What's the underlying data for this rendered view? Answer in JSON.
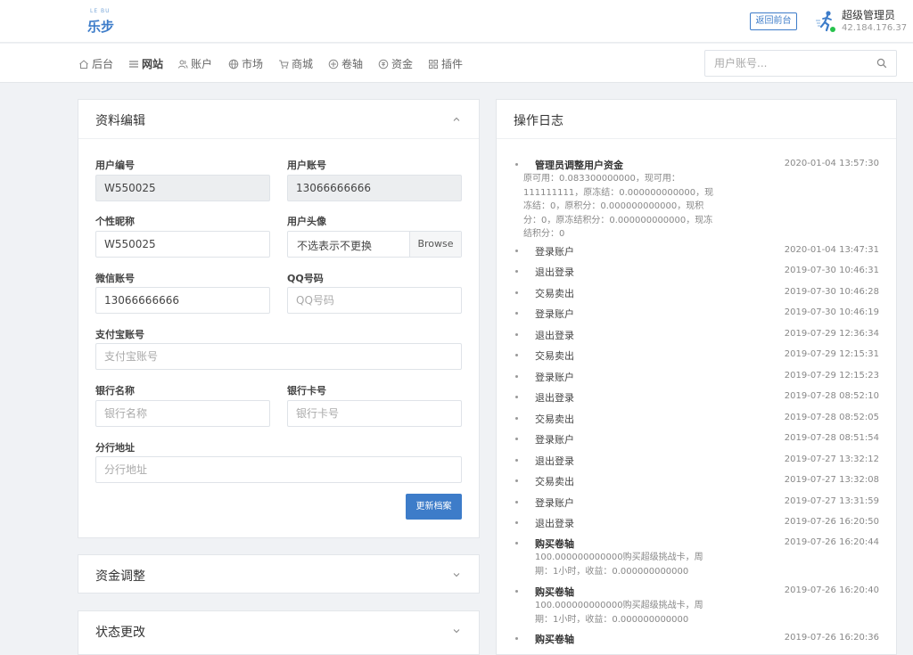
{
  "header": {
    "logo_sup": "LE BU",
    "logo_text": "乐步",
    "back_button": "返回前台",
    "admin_name": "超级管理员",
    "admin_ip": "42.184.176.37"
  },
  "nav": {
    "items": [
      {
        "label": "后台",
        "icon": "home-icon"
      },
      {
        "label": "网站",
        "icon": "list-icon"
      },
      {
        "label": "账户",
        "icon": "users-icon"
      },
      {
        "label": "市场",
        "icon": "globe-icon"
      },
      {
        "label": "商城",
        "icon": "cart-icon"
      },
      {
        "label": "卷轴",
        "icon": "scroll-icon"
      },
      {
        "label": "资金",
        "icon": "coin-icon"
      },
      {
        "label": "插件",
        "icon": "grid-icon"
      }
    ],
    "search_placeholder": "用户账号..."
  },
  "profile": {
    "title": "资料编辑",
    "user_id_label": "用户编号",
    "user_id_value": "W550025",
    "account_label": "用户账号",
    "account_value": "13066666666",
    "nickname_label": "个性昵称",
    "nickname_value": "W550025",
    "avatar_label": "用户头像",
    "avatar_value": "不选表示不更换",
    "avatar_button": "Browse",
    "wechat_label": "微信账号",
    "wechat_value": "13066666666",
    "qq_label": "QQ号码",
    "qq_placeholder": "QQ号码",
    "alipay_label": "支付宝账号",
    "alipay_placeholder": "支付宝账号",
    "bank_name_label": "银行名称",
    "bank_name_placeholder": "银行名称",
    "bank_card_label": "银行卡号",
    "bank_card_placeholder": "银行卡号",
    "branch_label": "分行地址",
    "branch_placeholder": "分行地址",
    "submit_label": "更新档案"
  },
  "funds": {
    "title": "资金调整"
  },
  "status": {
    "title": "状态更改"
  },
  "log": {
    "title": "操作日志",
    "entries": [
      {
        "title": "管理员调整用户资金",
        "time": "2020-01-04 13:57:30",
        "detail": "原可用：0.083300000000，现可用：111111111，原冻结：0.000000000000，现冻结：0，原积分：0.000000000000，现积分：0，原冻结积分：0.000000000000，现冻结积分：0"
      },
      {
        "title": "登录账户",
        "time": "2020-01-04 13:47:31"
      },
      {
        "title": "退出登录",
        "time": "2019-07-30 10:46:31"
      },
      {
        "title": "交易卖出",
        "time": "2019-07-30 10:46:28"
      },
      {
        "title": "登录账户",
        "time": "2019-07-30 10:46:19"
      },
      {
        "title": "退出登录",
        "time": "2019-07-29 12:36:34"
      },
      {
        "title": "交易卖出",
        "time": "2019-07-29 12:15:31"
      },
      {
        "title": "登录账户",
        "time": "2019-07-29 12:15:23"
      },
      {
        "title": "退出登录",
        "time": "2019-07-28 08:52:10"
      },
      {
        "title": "交易卖出",
        "time": "2019-07-28 08:52:05"
      },
      {
        "title": "登录账户",
        "time": "2019-07-28 08:51:54"
      },
      {
        "title": "退出登录",
        "time": "2019-07-27 13:32:12"
      },
      {
        "title": "交易卖出",
        "time": "2019-07-27 13:32:08"
      },
      {
        "title": "登录账户",
        "time": "2019-07-27 13:31:59"
      },
      {
        "title": "退出登录",
        "time": "2019-07-26 16:20:50"
      },
      {
        "title": "购买卷轴",
        "time": "2019-07-26 16:20:44",
        "detail": "100.000000000000购买超级挑战卡，周期：1小时，收益：0.000000000000"
      },
      {
        "title": "购买卷轴",
        "time": "2019-07-26 16:20:40",
        "detail": "100.000000000000购买超级挑战卡，周期：1小时，收益：0.000000000000"
      },
      {
        "title": "购买卷轴",
        "time": "2019-07-26 16:20:36"
      }
    ]
  }
}
